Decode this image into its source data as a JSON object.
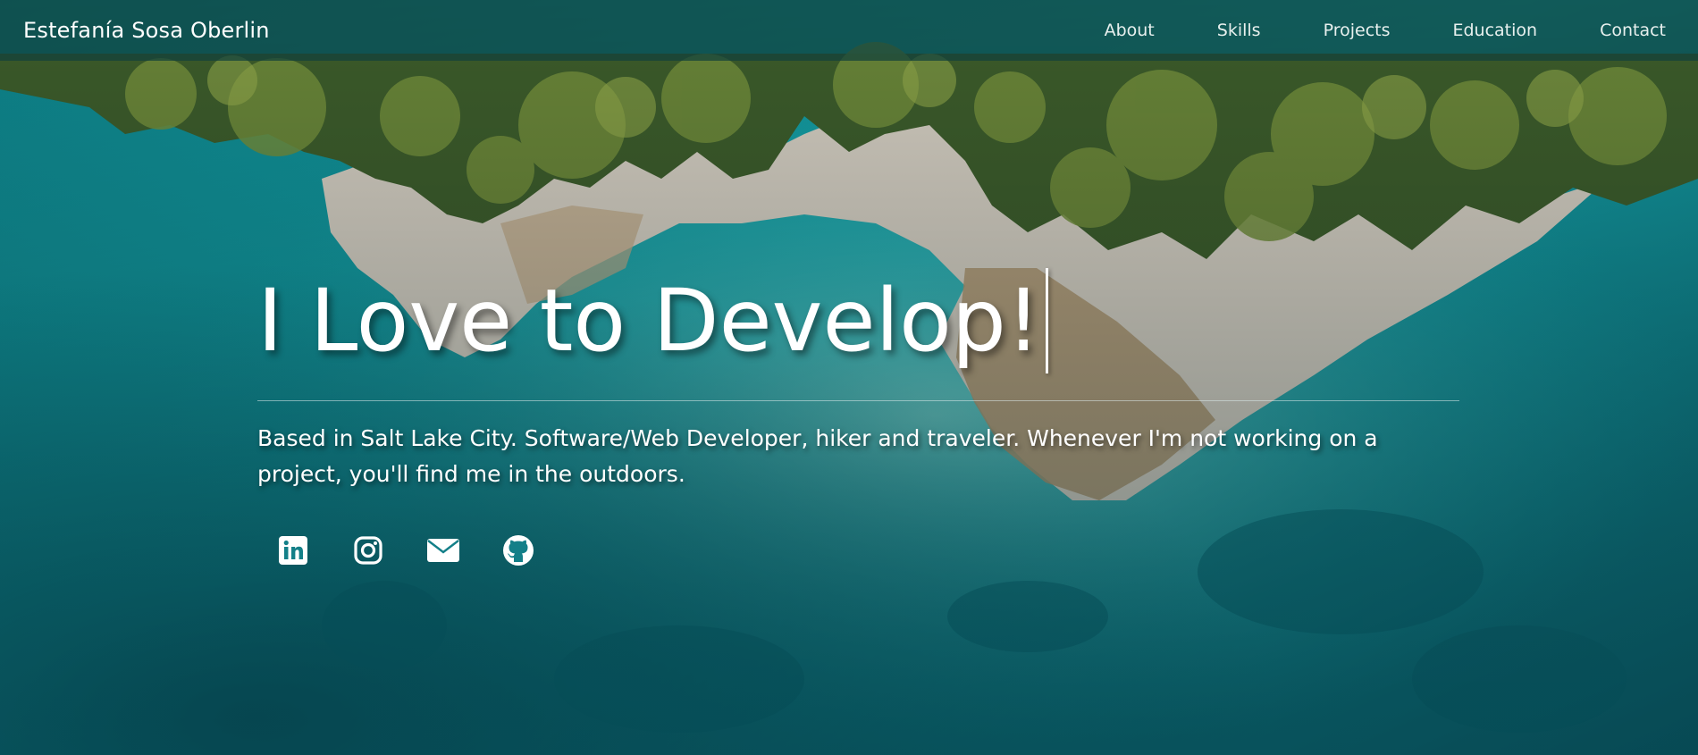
{
  "nav": {
    "brand": "Estefanía Sosa Oberlin",
    "links": [
      "About",
      "Skills",
      "Projects",
      "Education",
      "Contact"
    ]
  },
  "hero": {
    "title": "I Love to Develop!",
    "tagline": "Based in Salt Lake City. Software/Web Developer, hiker and traveler. Whenever I'm not working on a project, you'll find me in the outdoors."
  },
  "socials": [
    {
      "icon": "linkedin-icon"
    },
    {
      "icon": "instagram-icon"
    },
    {
      "icon": "envelope-icon"
    },
    {
      "icon": "github-icon"
    }
  ],
  "colors": {
    "navbar": "#10403c",
    "sea": "#0f8e95",
    "text": "#ffffff"
  }
}
